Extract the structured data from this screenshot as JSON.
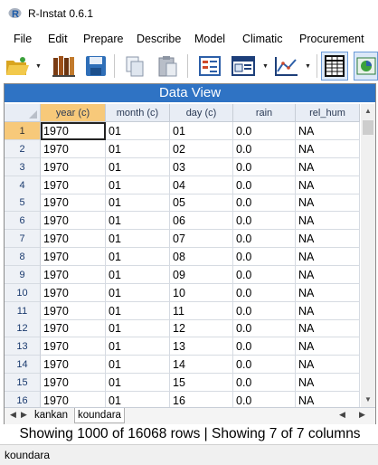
{
  "window": {
    "title": "R-Instat 0.6.1"
  },
  "menu": [
    "File",
    "Edit",
    "Prepare",
    "Describe",
    "Model",
    "Climatic",
    "Procurement"
  ],
  "toolbar": {
    "icons": [
      "open-folder",
      "library",
      "save",
      "copy",
      "paste",
      "output-window",
      "log-script",
      "line-graph",
      "data-grid",
      "data-frame-metadata"
    ]
  },
  "data_view": {
    "title": "Data View",
    "columns": [
      "year (c)",
      "month (c)",
      "day (c)",
      "rain",
      "rel_hum"
    ],
    "row_numbers": [
      "1",
      "2",
      "3",
      "4",
      "5",
      "6",
      "7",
      "8",
      "9",
      "10",
      "11",
      "12",
      "13",
      "14",
      "15",
      "16"
    ],
    "rows": [
      [
        "1970",
        "01",
        "01",
        "0.0",
        "NA"
      ],
      [
        "1970",
        "01",
        "02",
        "0.0",
        "NA"
      ],
      [
        "1970",
        "01",
        "03",
        "0.0",
        "NA"
      ],
      [
        "1970",
        "01",
        "04",
        "0.0",
        "NA"
      ],
      [
        "1970",
        "01",
        "05",
        "0.0",
        "NA"
      ],
      [
        "1970",
        "01",
        "06",
        "0.0",
        "NA"
      ],
      [
        "1970",
        "01",
        "07",
        "0.0",
        "NA"
      ],
      [
        "1970",
        "01",
        "08",
        "0.0",
        "NA"
      ],
      [
        "1970",
        "01",
        "09",
        "0.0",
        "NA"
      ],
      [
        "1970",
        "01",
        "10",
        "0.0",
        "NA"
      ],
      [
        "1970",
        "01",
        "11",
        "0.0",
        "NA"
      ],
      [
        "1970",
        "01",
        "12",
        "0.0",
        "NA"
      ],
      [
        "1970",
        "01",
        "13",
        "0.0",
        "NA"
      ],
      [
        "1970",
        "01",
        "14",
        "0.0",
        "NA"
      ],
      [
        "1970",
        "01",
        "15",
        "0.0",
        "NA"
      ],
      [
        "1970",
        "01",
        "16",
        "0.0",
        "NA"
      ]
    ],
    "selected_cell": {
      "row": 1,
      "column": "year (c)"
    },
    "sheets": [
      "kankan",
      "koundara"
    ],
    "active_sheet": "koundara"
  },
  "status": {
    "summary": "Showing 1000 of 16068 rows | Showing 7 of 7 columns",
    "current_data_frame": "koundara"
  },
  "colors": {
    "header_blue": "#2f73c4",
    "selection_orange": "#f7c97a"
  }
}
